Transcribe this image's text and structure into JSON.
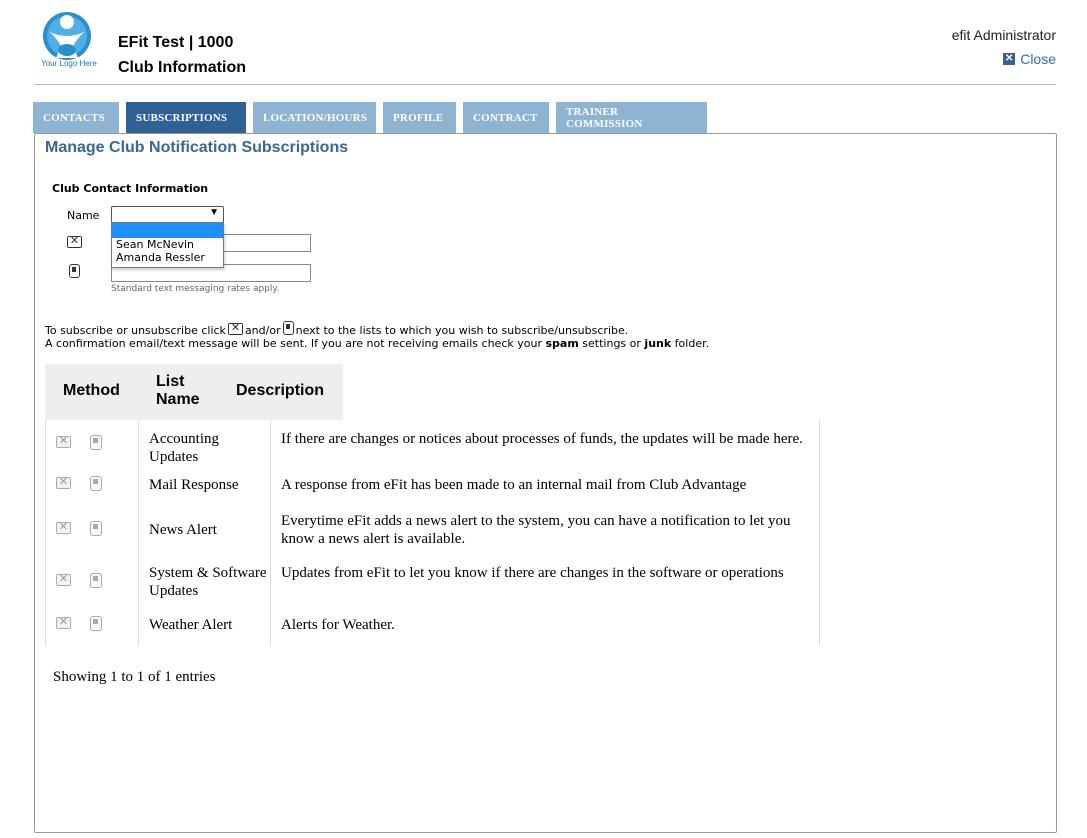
{
  "header": {
    "logo_caption": "Your Logo Here",
    "club_line1": "EFit Test | 1000",
    "club_line2": "Club Information",
    "user": "efit Administrator",
    "close_label": "Close"
  },
  "tabs": [
    {
      "label": "Contacts",
      "active": false
    },
    {
      "label": "Subscriptions",
      "active": true
    },
    {
      "label": "Location/Hours",
      "active": false
    },
    {
      "label": "Profile",
      "active": false
    },
    {
      "label": "Contract",
      "active": false
    },
    {
      "label": "Trainer Commission",
      "active": false
    }
  ],
  "page": {
    "title": "Manage Club Notification Subscriptions",
    "section_label": "Club Contact Information",
    "name_label": "Name",
    "name_value": "",
    "name_options": [
      "",
      "Sean McNevin",
      "Amanda Ressler"
    ],
    "email_value": "",
    "phone_value": "",
    "hint": "Standard text messaging rates apply.",
    "instr_part1": "To subscribe or unsubscribe click",
    "instr_part2": "and/or",
    "instr_part3": "next to the lists to which you wish to subscribe/unsubscribe.",
    "instr2_part1": "A confirmation email/text message will be sent. If you are not receiving emails check your",
    "instr2_spam": "spam",
    "instr2_part2": "settings or",
    "instr2_junk": "junk",
    "instr2_part3": "folder."
  },
  "table": {
    "headers": {
      "method": "Method",
      "list_name_1": "List",
      "list_name_2": "Name",
      "description": "Description"
    },
    "rows": [
      {
        "name": "Accounting Updates",
        "description": "If there are changes or notices about processes of funds, the updates will be made here."
      },
      {
        "name": "Mail Response",
        "description": "A response from eFit has been made to an internal mail from Club Advantage"
      },
      {
        "name": "News Alert",
        "description": "Everytime eFit adds a news alert to the system, you can have a notification to let you know a news alert is available."
      },
      {
        "name": "System & Software Updates",
        "description": "Updates from eFit to let you know if there are changes in the software or operations"
      },
      {
        "name": "Weather Alert",
        "description": "Alerts for Weather."
      }
    ],
    "footer": "Showing 1 to 1 of 1 entries"
  },
  "colors": {
    "tab_active": "#2f6096",
    "tab_inactive": "#8fb4d2",
    "title_blue": "#3a6795",
    "dropdown_highlight": "#1e90ff"
  },
  "icons": {
    "logo": "person-figure-logo",
    "close": "close-icon",
    "mail": "mail-icon",
    "phone": "phone-icon"
  }
}
